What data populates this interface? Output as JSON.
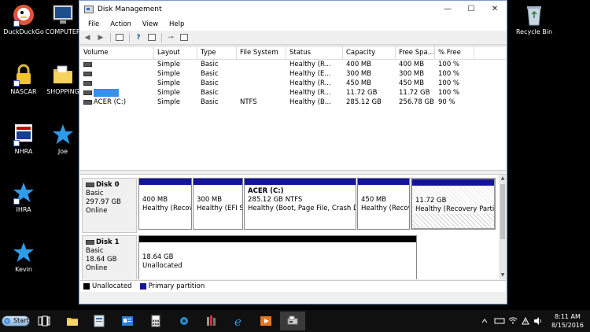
{
  "desktop": {
    "icons": [
      {
        "label": "DuckDuckGo"
      },
      {
        "label": "COMPUTER"
      },
      {
        "label": "NASCAR"
      },
      {
        "label": "SHOPPING"
      },
      {
        "label": "NHRA"
      },
      {
        "label": "Joe"
      },
      {
        "label": "IHRA"
      },
      {
        "label": "Kevin"
      },
      {
        "label": "Recycle Bin"
      }
    ]
  },
  "window": {
    "title": "Disk Management",
    "controls": {
      "minimize": "—",
      "maximize": "☐",
      "close": "✕"
    },
    "menu": [
      "File",
      "Action",
      "View",
      "Help"
    ],
    "volume_columns": [
      "Volume",
      "Layout",
      "Type",
      "File System",
      "Status",
      "Capacity",
      "Free Spa...",
      "% Free"
    ],
    "volumes": [
      {
        "volume": "",
        "layout": "Simple",
        "type": "Basic",
        "fs": "",
        "status": "Healthy (R...",
        "capacity": "400 MB",
        "free": "400 MB",
        "pct": "100 %"
      },
      {
        "volume": "",
        "layout": "Simple",
        "type": "Basic",
        "fs": "",
        "status": "Healthy (E...",
        "capacity": "300 MB",
        "free": "300 MB",
        "pct": "100 %"
      },
      {
        "volume": "",
        "layout": "Simple",
        "type": "Basic",
        "fs": "",
        "status": "Healthy (R...",
        "capacity": "450 MB",
        "free": "450 MB",
        "pct": "100 %"
      },
      {
        "volume": "",
        "layout": "Simple",
        "type": "Basic",
        "fs": "",
        "status": "Healthy (R...",
        "capacity": "11.72 GB",
        "free": "11.72 GB",
        "pct": "100 %"
      },
      {
        "volume": "ACER (C:)",
        "layout": "Simple",
        "type": "Basic",
        "fs": "NTFS",
        "status": "Healthy (B...",
        "capacity": "285.12 GB",
        "free": "256.78 GB",
        "pct": "90 %"
      }
    ],
    "disks": [
      {
        "name": "Disk 0",
        "kind": "Basic",
        "size": "297.97 GB",
        "state": "Online",
        "partitions": [
          {
            "title": "",
            "line1": "400 MB",
            "line2": "Healthy (Recov"
          },
          {
            "title": "",
            "line1": "300 MB",
            "line2": "Healthy (EFI S"
          },
          {
            "title": "ACER  (C:)",
            "line1": "285.12 GB NTFS",
            "line2": "Healthy (Boot, Page File, Crash Du"
          },
          {
            "title": "",
            "line1": "450 MB",
            "line2": "Healthy (Recov"
          },
          {
            "title": "",
            "line1": "11.72 GB",
            "line2": "Healthy (Recovery Partitio"
          }
        ]
      },
      {
        "name": "Disk 1",
        "kind": "Basic",
        "size": "18.64 GB",
        "state": "Online",
        "partitions": [
          {
            "title": "",
            "line1": "18.64 GB",
            "line2": "Unallocated"
          }
        ]
      }
    ],
    "legend": [
      {
        "label": "Unallocated",
        "color": "#000000"
      },
      {
        "label": "Primary partition",
        "color": "#14149a"
      }
    ]
  },
  "taskbar": {
    "start_label": "Start",
    "clock": {
      "time": "8:11 AM",
      "date": "8/15/2016"
    }
  },
  "colors": {
    "primary_partition": "#14149a",
    "selection": "#3a8de8",
    "desktop": "#000000"
  }
}
